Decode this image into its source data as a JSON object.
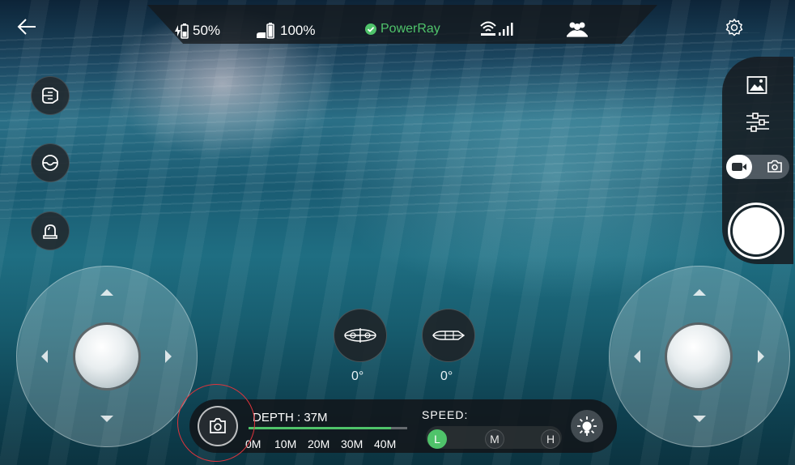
{
  "status_bar": {
    "drone_battery": "50%",
    "remote_battery": "100%",
    "connection_name": "PowerRay",
    "connection_color": "#4fc36a"
  },
  "left_controls": [
    "flashlight-icon",
    "tilt-icon",
    "alarm-icon"
  ],
  "right_panel": {
    "icons": [
      "gallery-icon",
      "settings-sliders-icon",
      "video-mode-icon",
      "photo-mode-icon"
    ],
    "active_mode": "video"
  },
  "attitude": {
    "roll": "0°",
    "pitch": "0°"
  },
  "depth": {
    "label": "DEPTH : 37M",
    "level_fraction": 0.9,
    "ticks": [
      "0M",
      "10M",
      "20M",
      "30M",
      "40M"
    ]
  },
  "speed": {
    "label": "SPEED:",
    "options": [
      "L",
      "M",
      "H"
    ],
    "selected": "L"
  },
  "colors": {
    "accent": "#4fc36a",
    "annotation": "#e0343c"
  }
}
